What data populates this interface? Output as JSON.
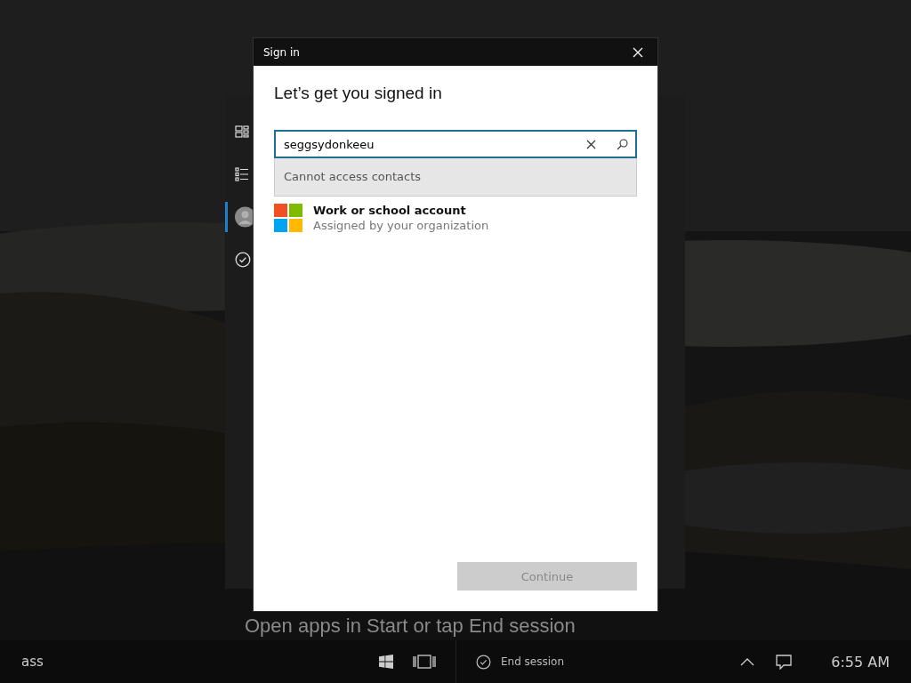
{
  "side_panel": {
    "items": [
      {
        "kind": "grid",
        "selected": false
      },
      {
        "kind": "list",
        "selected": false
      },
      {
        "kind": "avatar",
        "selected": true
      },
      {
        "kind": "check",
        "selected": false
      }
    ],
    "hint": "Open apps in Start or tap End session"
  },
  "dialog": {
    "title": "Sign in",
    "heading": "Let’s get you signed in",
    "search": {
      "value": "seggsydonkeeu",
      "focused": true
    },
    "suggestion": "Cannot access contacts",
    "account": {
      "title": "Work or school account",
      "subtitle": "Assigned by your organization"
    },
    "continue_button": {
      "label": "Continue",
      "disabled": true
    }
  },
  "taskbar": {
    "user": "ass",
    "end_session": "End session",
    "time": "6:55 AM"
  }
}
